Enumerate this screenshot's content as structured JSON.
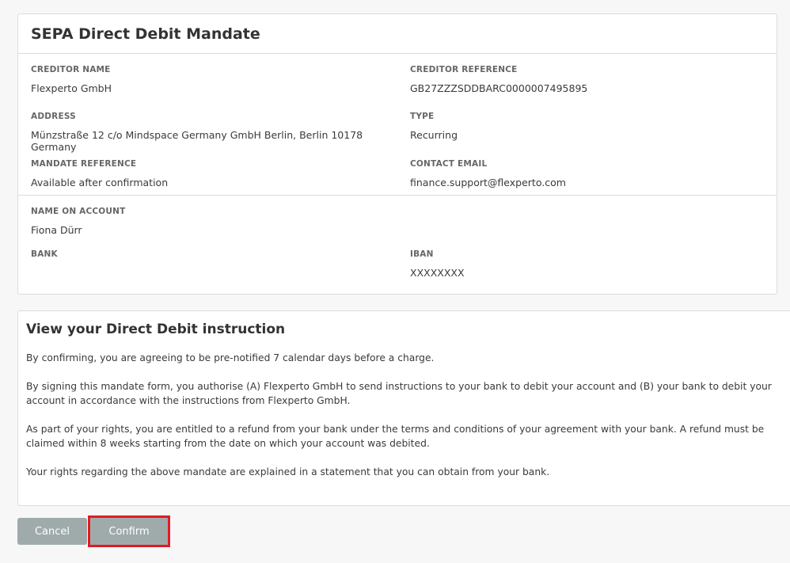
{
  "mandate": {
    "title": "SEPA Direct Debit Mandate",
    "creditor_name_label": "CREDITOR NAME",
    "creditor_name": "Flexperto GmbH",
    "creditor_reference_label": "CREDITOR REFERENCE",
    "creditor_reference": "GB27ZZZSDDBARC0000007495895",
    "address_label": "ADDRESS",
    "address": "Münzstraße 12 c/o Mindspace Germany GmbH Berlin, Berlin 10178 Germany",
    "type_label": "TYPE",
    "type": "Recurring",
    "mandate_reference_label": "MANDATE REFERENCE",
    "mandate_reference": "Available after confirmation",
    "contact_email_label": "CONTACT EMAIL",
    "contact_email": "finance.support@flexperto.com",
    "name_on_account_label": "NAME ON ACCOUNT",
    "name_on_account": "Fiona Dürr",
    "bank_label": "BANK",
    "bank": "",
    "iban_label": "IBAN",
    "iban": "XXXXXXXX"
  },
  "instruction": {
    "title": "View your Direct Debit instruction",
    "paragraphs": [
      "By confirming, you are agreeing to be pre-notified 7 calendar days before a charge.",
      "By signing this mandate form, you authorise (A) Flexperto GmbH to send instructions to your bank to debit your account and (B) your bank to debit your account in accordance with the instructions from Flexperto GmbH.",
      "As part of your rights, you are entitled to a refund from your bank under the terms and conditions of your agreement with your bank. A refund must be claimed within 8 weeks starting from the date on which your account was debited.",
      "Your rights regarding the above mandate are explained in a statement that you can obtain from your bank."
    ]
  },
  "actions": {
    "cancel": "Cancel",
    "confirm": "Confirm"
  }
}
